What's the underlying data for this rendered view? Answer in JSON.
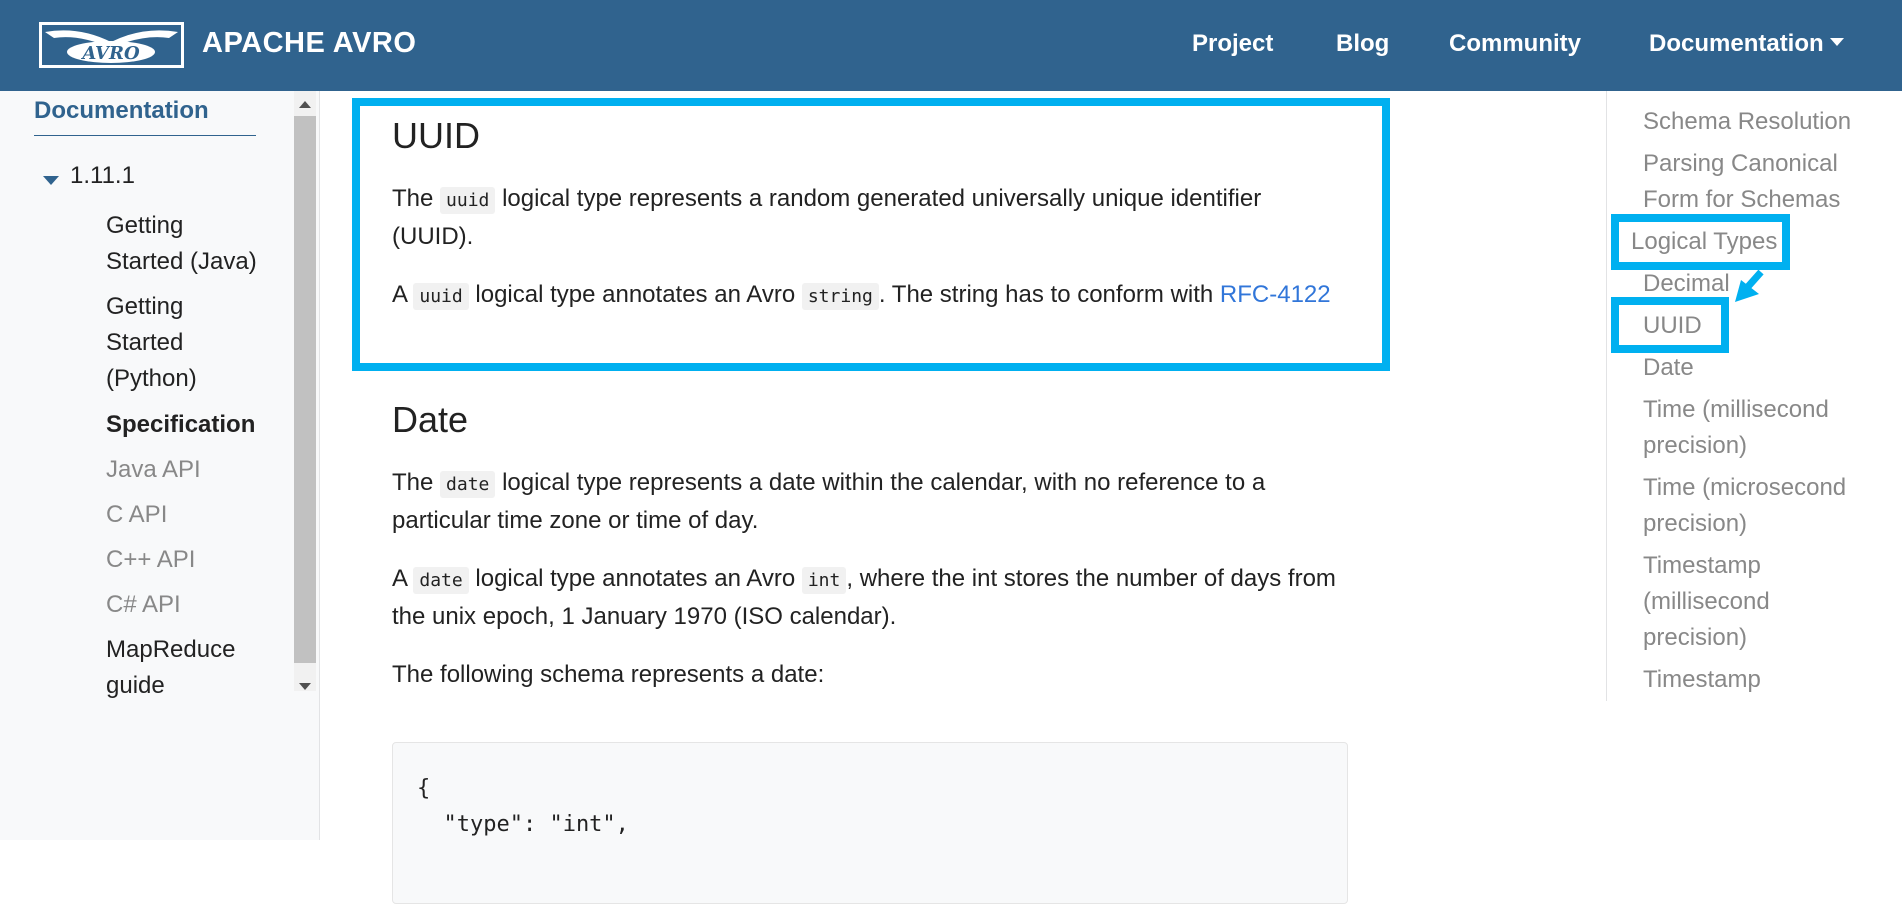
{
  "navbar": {
    "brand": "APACHE AVRO",
    "logo_text": "AVRO",
    "links": [
      "Project",
      "Blog",
      "Community",
      "Documentation"
    ]
  },
  "sidebar": {
    "title": "Documentation",
    "version": "1.11.1",
    "items": [
      {
        "label": "Getting Started (Java)"
      },
      {
        "label": "Getting Started (Python)"
      },
      {
        "label": "Specification"
      },
      {
        "label": "Java API"
      },
      {
        "label": "C API"
      },
      {
        "label": "C++ API"
      },
      {
        "label": "C# API"
      },
      {
        "label": "MapReduce guide"
      }
    ]
  },
  "main": {
    "uuid": {
      "heading": "UUID",
      "p1_a": "The",
      "p1_code": "uuid",
      "p1_b": "logical type represents a random generated universally unique identifier (UUID).",
      "p2_a": "A",
      "p2_code": "uuid",
      "p2_b": "logical type annotates an Avro",
      "p2_code2": "string",
      "p2_c": ". The string has to conform with",
      "p2_link": "RFC-4122"
    },
    "date": {
      "heading": "Date",
      "p1_a": "The",
      "p1_code": "date",
      "p1_b": "logical type represents a date within the calendar, with no reference to a particular time zone or time of day.",
      "p2_a": "A",
      "p2_code": "date",
      "p2_b": "logical type annotates an Avro",
      "p2_code2": "int",
      "p2_c": ", where the int stores the number of days from the unix epoch, 1 January 1970 (ISO calendar).",
      "p3": "The following schema represents a date:",
      "code_lines": [
        "{",
        "  \"type\": \"int\","
      ]
    }
  },
  "toc": {
    "items": [
      "Schema Resolution",
      "Parsing Canonical Form for Schemas",
      "Logical Types",
      "Decimal",
      "UUID",
      "Date",
      "Time (millisecond precision)",
      "Time (microsecond precision)",
      "Timestamp (millisecond precision)",
      "Timestamp"
    ]
  },
  "colors": {
    "navbar": "#30638e",
    "highlight": "#00b0f0",
    "link": "#3176d9"
  }
}
